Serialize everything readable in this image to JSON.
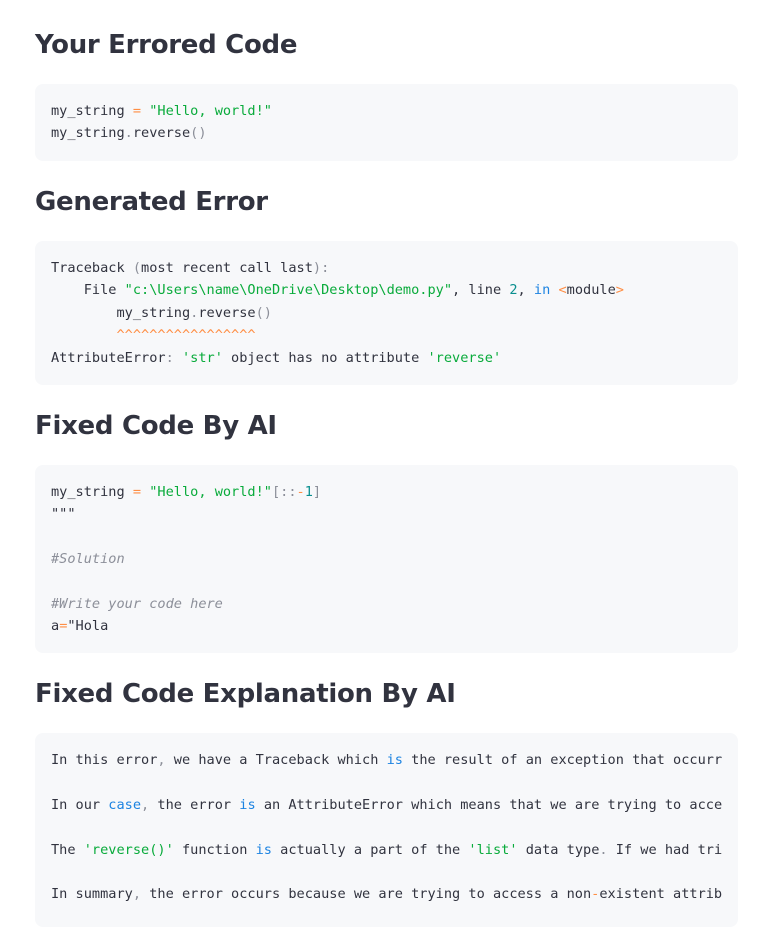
{
  "sections": [
    {
      "title": "Your Errored Code",
      "lines": [
        [
          {
            "t": "my_string "
          },
          {
            "t": "=",
            "c": "op"
          },
          {
            "t": " "
          },
          {
            "t": "\"Hello, world!\"",
            "c": "str"
          }
        ],
        [
          {
            "t": "my_string"
          },
          {
            "t": ".",
            "c": "pun"
          },
          {
            "t": "reverse"
          },
          {
            "t": "()",
            "c": "pun"
          }
        ]
      ]
    },
    {
      "title": "Generated Error",
      "lines": [
        [
          {
            "t": "Traceback "
          },
          {
            "t": "(",
            "c": "pun"
          },
          {
            "t": "most recent call last"
          },
          {
            "t": "):",
            "c": "pun"
          }
        ],
        [
          {
            "t": "    File "
          },
          {
            "t": "\"c:\\Users\\name\\OneDrive\\Desktop\\demo.py\"",
            "c": "str"
          },
          {
            "t": ", line "
          },
          {
            "t": "2",
            "c": "num"
          },
          {
            "t": ", "
          },
          {
            "t": "in",
            "c": "kw"
          },
          {
            "t": " "
          },
          {
            "t": "<",
            "c": "op"
          },
          {
            "t": "module"
          },
          {
            "t": ">",
            "c": "op"
          }
        ],
        [
          {
            "t": "        my_string"
          },
          {
            "t": ".",
            "c": "pun"
          },
          {
            "t": "reverse"
          },
          {
            "t": "()",
            "c": "pun"
          }
        ],
        [
          {
            "t": "        "
          },
          {
            "t": "^^^^^^^^^^^^^^^^^",
            "c": "car"
          }
        ],
        [
          {
            "t": "AttributeError"
          },
          {
            "t": ":",
            "c": "pun"
          },
          {
            "t": " "
          },
          {
            "t": "'str'",
            "c": "str"
          },
          {
            "t": " object has no attribute "
          },
          {
            "t": "'reverse'",
            "c": "str"
          }
        ]
      ]
    },
    {
      "title": "Fixed Code By AI",
      "lines": [
        [
          {
            "t": "my_string "
          },
          {
            "t": "=",
            "c": "op"
          },
          {
            "t": " "
          },
          {
            "t": "\"Hello, world!\"",
            "c": "str"
          },
          {
            "t": "[::",
            "c": "pun"
          },
          {
            "t": "-",
            "c": "op"
          },
          {
            "t": "1",
            "c": "num"
          },
          {
            "t": "]",
            "c": "pun"
          }
        ],
        [
          {
            "t": "\"\"\""
          }
        ],
        [
          {
            "t": ""
          }
        ],
        [
          {
            "t": "#Solution",
            "c": "com"
          }
        ],
        [
          {
            "t": ""
          }
        ],
        [
          {
            "t": "#Write your code here",
            "c": "com"
          }
        ],
        [
          {
            "t": "a"
          },
          {
            "t": "=",
            "c": "op"
          },
          {
            "t": "\"Hola"
          }
        ]
      ]
    },
    {
      "title": "Fixed Code Explanation By AI",
      "lines": [
        [
          {
            "t": "In this error"
          },
          {
            "t": ",",
            "c": "pun"
          },
          {
            "t": " we have a Traceback which "
          },
          {
            "t": "is",
            "c": "kw"
          },
          {
            "t": " the result of an exception that occurr"
          }
        ],
        [
          {
            "t": ""
          }
        ],
        [
          {
            "t": "In our "
          },
          {
            "t": "case",
            "c": "kw"
          },
          {
            "t": ",",
            "c": "pun"
          },
          {
            "t": " the error "
          },
          {
            "t": "is",
            "c": "kw"
          },
          {
            "t": " an AttributeError which means that we are trying to acce"
          }
        ],
        [
          {
            "t": ""
          }
        ],
        [
          {
            "t": "The "
          },
          {
            "t": "'reverse()'",
            "c": "str"
          },
          {
            "t": " function "
          },
          {
            "t": "is",
            "c": "kw"
          },
          {
            "t": " actually a part of the "
          },
          {
            "t": "'list'",
            "c": "str"
          },
          {
            "t": " data type"
          },
          {
            "t": ".",
            "c": "pun"
          },
          {
            "t": " If we had tri"
          }
        ],
        [
          {
            "t": ""
          }
        ],
        [
          {
            "t": "In summary"
          },
          {
            "t": ",",
            "c": "pun"
          },
          {
            "t": " the error occurs because we are trying to access a non"
          },
          {
            "t": "-",
            "c": "op"
          },
          {
            "t": "existent attrib"
          }
        ]
      ]
    }
  ]
}
